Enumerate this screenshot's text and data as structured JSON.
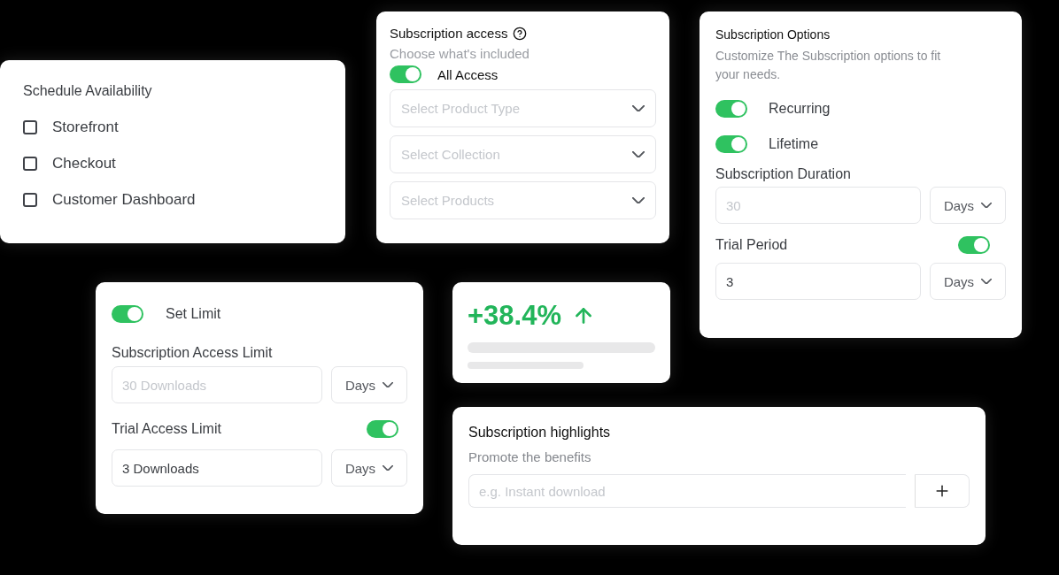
{
  "schedule": {
    "title": "Schedule Availability",
    "options": [
      {
        "label": "Storefront",
        "checked": false
      },
      {
        "label": "Checkout",
        "checked": false
      },
      {
        "label": "Customer Dashboard",
        "checked": false
      }
    ]
  },
  "access": {
    "title": "Subscription access",
    "subtitle": "Choose what's included",
    "toggle": {
      "label": "All Access",
      "on": true
    },
    "selects": [
      {
        "placeholder": "Select Product Type"
      },
      {
        "placeholder": "Select Collection"
      },
      {
        "placeholder": "Select Products"
      }
    ]
  },
  "options": {
    "title": "Subscription Options",
    "description": "Customize The Subscription options to fit your needs.",
    "toggles": [
      {
        "label": "Recurring",
        "on": true
      },
      {
        "label": "Lifetime",
        "on": true
      }
    ],
    "duration": {
      "label": "Subscription Duration",
      "input": {
        "placeholder": "30"
      },
      "unit": "Days"
    },
    "trial": {
      "label": "Trial Period",
      "on": true,
      "input": {
        "value": "3"
      },
      "unit": "Days"
    }
  },
  "limit": {
    "toggle": {
      "label": "Set Limit",
      "on": true
    },
    "access_limit": {
      "label": "Subscription Access Limit",
      "input": {
        "placeholder": "30 Downloads"
      },
      "unit": "Days"
    },
    "trial_limit": {
      "label": "Trial Access Limit",
      "on": true,
      "input": {
        "value": "3 Downloads"
      },
      "unit": "Days"
    }
  },
  "stat": {
    "value": "+38.4%"
  },
  "highlights": {
    "title": "Subscription highlights",
    "subtitle": "Promote the benefits",
    "input": {
      "placeholder": "e.g. Instant download"
    }
  }
}
